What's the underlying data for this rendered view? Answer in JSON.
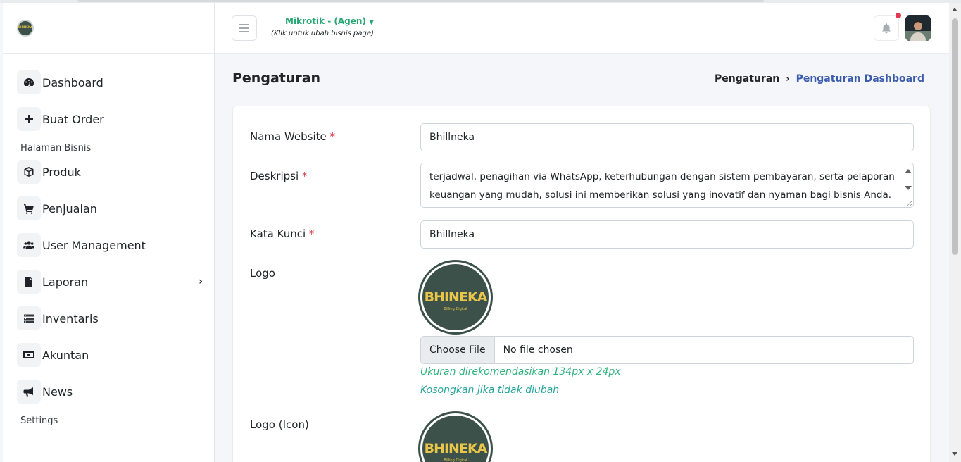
{
  "header": {
    "business_name": "Mikrotik - (Agen)",
    "business_hint": "(Klik untuk ubah bisnis page)"
  },
  "sidebar": {
    "brand_text": "BHINEKA",
    "items": [
      {
        "label": "Dashboard",
        "icon": "dashboard-icon"
      },
      {
        "label": "Buat Order",
        "icon": "plus-icon"
      },
      {
        "label": "Produk",
        "icon": "box-icon"
      },
      {
        "label": "Penjualan",
        "icon": "cart-icon"
      },
      {
        "label": "User Management",
        "icon": "users-icon"
      },
      {
        "label": "Laporan",
        "icon": "file-icon"
      },
      {
        "label": "Inventaris",
        "icon": "list-icon"
      },
      {
        "label": "Akuntan",
        "icon": "money-icon"
      },
      {
        "label": "News",
        "icon": "megaphone-icon"
      }
    ],
    "sections": {
      "business": "Halaman Bisnis",
      "settings": "Settings"
    }
  },
  "page": {
    "title": "Pengaturan",
    "breadcrumb": [
      "Pengaturan",
      "Pengaturan Dashboard"
    ]
  },
  "form": {
    "website_name_label": "Nama Website",
    "website_name_value": "Bhillneka",
    "description_label": "Deskripsi",
    "description_line1": "terjadwal, penagihan via WhatsApp, keterhubungan dengan sistem pembayaran, serta pelaporan",
    "description_line2": "keuangan yang mudah, solusi ini memberikan solusi yang inovatif dan nyaman bagi bisnis Anda.",
    "keyword_label": "Kata Kunci",
    "keyword_value": "Bhillneka",
    "logo_label": "Logo",
    "logo_icon_label": "Logo (Icon)",
    "logo_text": "BHINEKA",
    "logo_subtext": "Billing Digital",
    "file_button": "Choose File",
    "file_status": "No file chosen",
    "hint_size": "Ukuran direkomendasikan 134px x 24px",
    "hint_empty": "Kosongkan jika tidak diubah",
    "required_mark": "*"
  },
  "colors": {
    "accent_green": "#28a874",
    "breadcrumb_active": "#3b5cad",
    "required": "#dc3545",
    "notification_dot": "#e4394d"
  }
}
